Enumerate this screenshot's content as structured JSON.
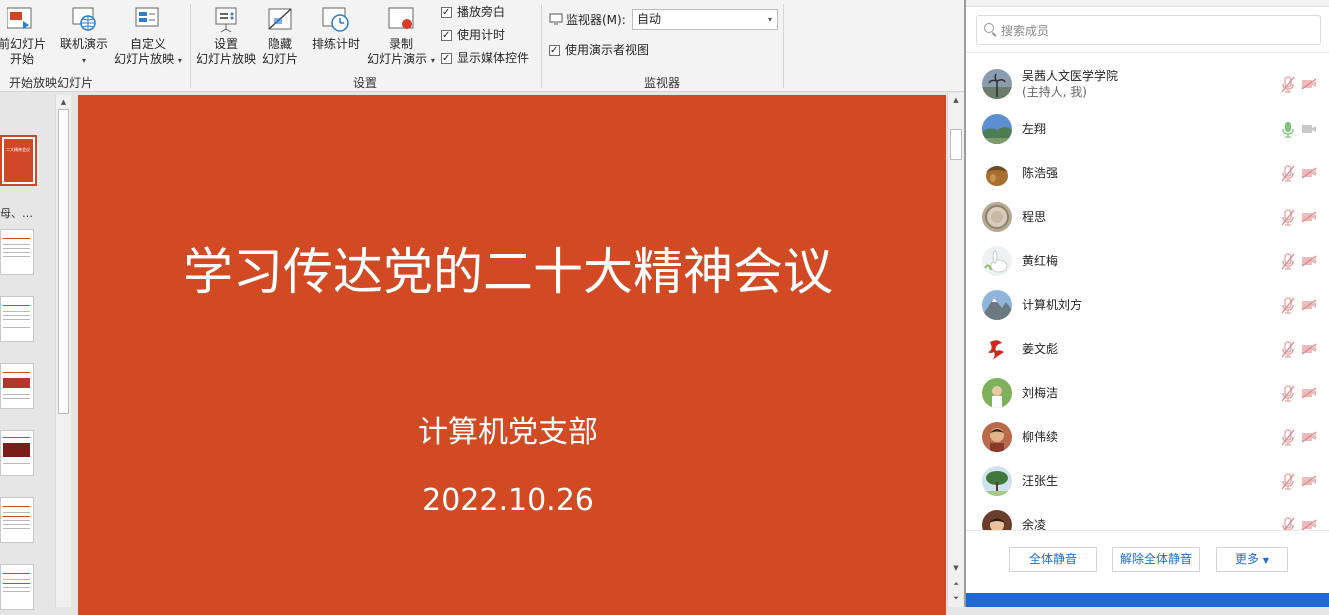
{
  "ribbon": {
    "btn_from_current": "前幻灯片\n开始",
    "btn_online": "联机演示",
    "btn_custom_l1": "自定义",
    "btn_custom_l2": "幻灯片放映",
    "group_start": "开始放映幻灯片",
    "btn_setup_l1": "设置",
    "btn_setup_l2": "幻灯片放映",
    "btn_hide_l1": "隐藏",
    "btn_hide_l2": "幻灯片",
    "btn_rehearse": "排练计时",
    "btn_record_l1": "录制",
    "btn_record_l2": "幻灯片演示",
    "chk_narration": "播放旁白",
    "chk_timings": "使用计时",
    "chk_media": "显示媒体控件",
    "group_setup": "设置",
    "monitor_label": "监视器(M):",
    "monitor_value": "自动",
    "chk_presenter": "使用演示者视图",
    "group_monitor": "监视器"
  },
  "thumbs": {
    "caption": "母、…",
    "active_text": "二大精神会议"
  },
  "slide": {
    "title": "学习传达党的二十大精神会议",
    "subtitle": "计算机党支部",
    "date": "2022.10.26"
  },
  "panel": {
    "search_placeholder": "搜索成员",
    "members": [
      {
        "name": "吴茜人文医学学院",
        "sub": "(主持人, 我)",
        "mic": "muted"
      },
      {
        "name": "左翔",
        "mic": "on"
      },
      {
        "name": "陈浩强",
        "mic": "muted"
      },
      {
        "name": "程思",
        "mic": "muted"
      },
      {
        "name": "黄红梅",
        "mic": "muted"
      },
      {
        "name": "计算机刘方",
        "mic": "muted"
      },
      {
        "name": "姜文彪",
        "mic": "muted"
      },
      {
        "name": "刘梅洁",
        "mic": "muted"
      },
      {
        "name": "柳伟续",
        "mic": "muted"
      },
      {
        "name": "汪张生",
        "mic": "muted"
      },
      {
        "name": "余凌",
        "mic": "muted"
      }
    ],
    "btn_mute_all": "全体静音",
    "btn_unmute_all": "解除全体静音",
    "btn_more": "更多"
  },
  "colors": {
    "slide_bg": "#d14a24",
    "accent": "#1a6fd1",
    "muted_icon": "#e3a3a3",
    "mic_on": "#7cc47a"
  }
}
